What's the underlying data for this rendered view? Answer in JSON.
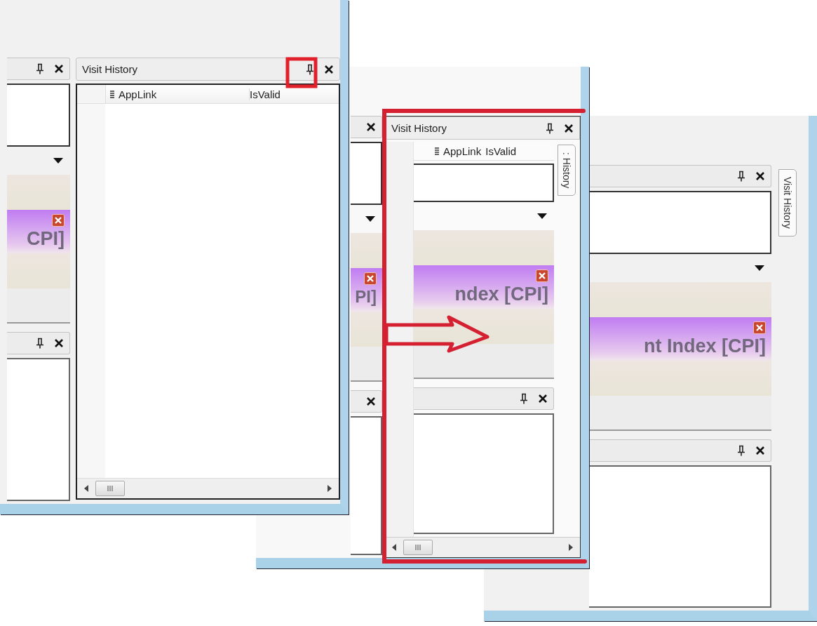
{
  "snapshots": [
    {
      "kind": "docked",
      "left_panes": [
        {
          "kind": "header",
          "pin": true
        },
        {
          "kind": "box"
        },
        {
          "kind": "toolbar"
        },
        {
          "kind": "band"
        },
        {
          "kind": "banner",
          "text": "CPI]"
        },
        {
          "kind": "band"
        },
        {
          "kind": "plain"
        },
        {
          "kind": "header",
          "pin": true
        },
        {
          "kind": "box"
        }
      ],
      "visit_history": {
        "title": "Visit History",
        "columns": [
          "AppLink",
          "IsValid"
        ]
      }
    },
    {
      "kind": "sliding",
      "left_panes": [
        {
          "kind": "header",
          "pin": false
        },
        {
          "kind": "box"
        },
        {
          "kind": "toolbar"
        },
        {
          "kind": "band"
        },
        {
          "kind": "banner",
          "text": "PI]"
        },
        {
          "kind": "band"
        },
        {
          "kind": "plain"
        },
        {
          "kind": "header",
          "pin": false
        },
        {
          "kind": "box"
        }
      ],
      "visit_history": {
        "title": "Visit History",
        "columns": [
          "AppLink",
          "IsValid"
        ],
        "side_tab": ": History",
        "underlying_panes": [
          {
            "kind": "box"
          },
          {
            "kind": "toolbar"
          },
          {
            "kind": "band"
          },
          {
            "kind": "banner",
            "text": "ndex [CPI]"
          },
          {
            "kind": "band"
          },
          {
            "kind": "plain"
          },
          {
            "kind": "header",
            "pin": true
          },
          {
            "kind": "box"
          }
        ]
      }
    },
    {
      "kind": "collapsed",
      "left_panes": [
        {
          "kind": "header",
          "pin": true
        },
        {
          "kind": "box"
        },
        {
          "kind": "toolbar"
        },
        {
          "kind": "band"
        },
        {
          "kind": "banner",
          "text": "nt Index [CPI]"
        },
        {
          "kind": "band"
        },
        {
          "kind": "plain"
        },
        {
          "kind": "header",
          "pin": true
        },
        {
          "kind": "box"
        }
      ],
      "side_tab": "Visit History"
    }
  ],
  "annotations": [
    {
      "kind": "highlight-box"
    },
    {
      "kind": "bracket"
    },
    {
      "kind": "arrow"
    }
  ]
}
